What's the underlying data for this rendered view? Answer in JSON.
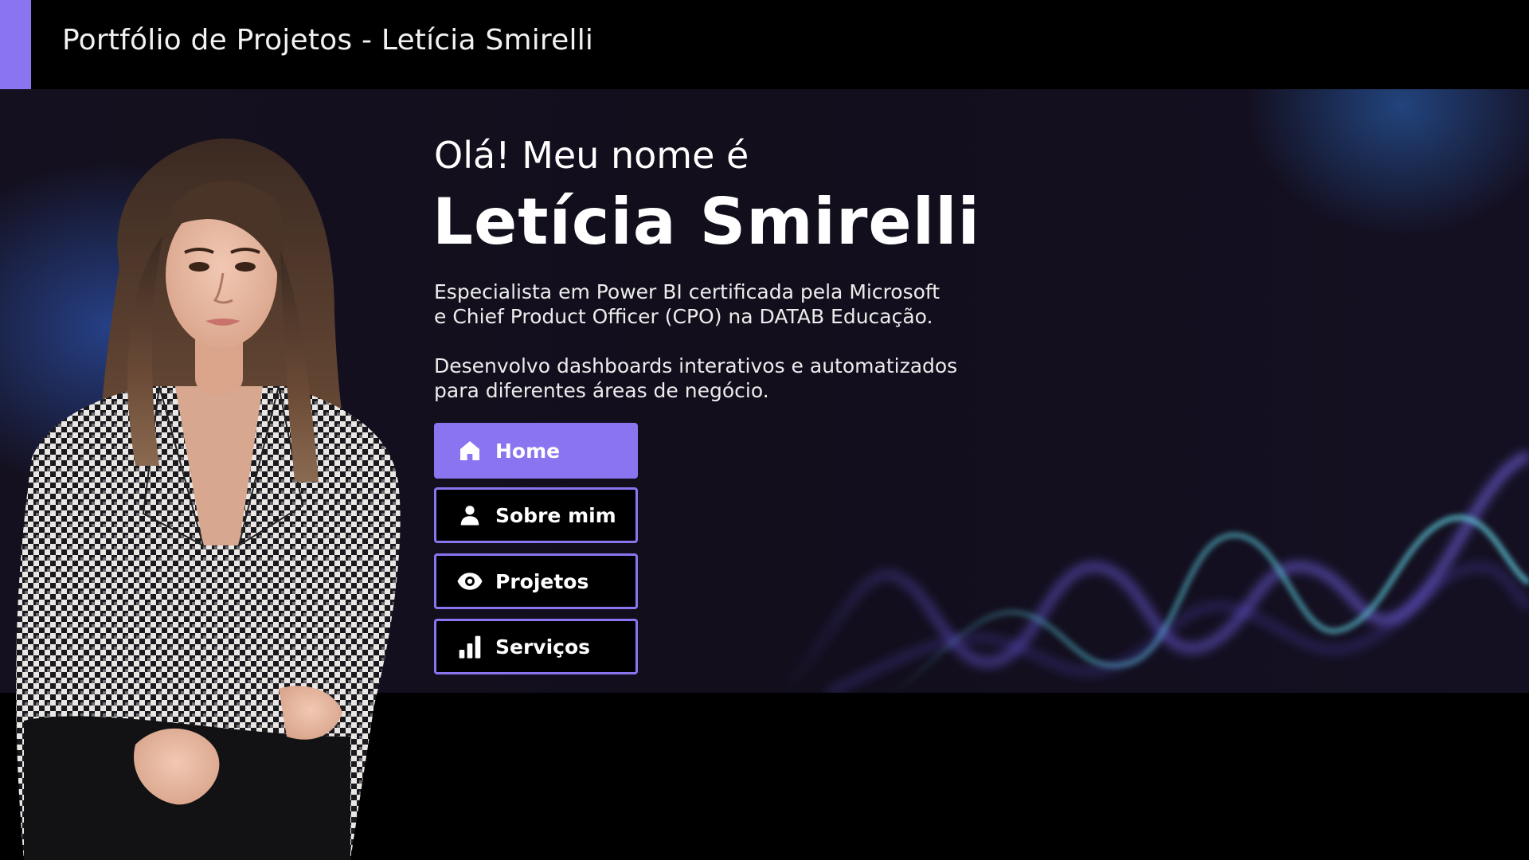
{
  "header": {
    "title": "Portfólio de Projetos - Letícia Smirelli"
  },
  "hero": {
    "greeting": "Olá! Meu nome é",
    "name": "Letícia Smirelli",
    "description_1_line_1": "Especialista em Power BI certificada pela Microsoft",
    "description_1_line_2": "e Chief Product Officer (CPO) na DATAB Educação.",
    "description_2_line_1": "Desenvolvo dashboards interativos e automatizados",
    "description_2_line_2": "para diferentes áreas de negócio."
  },
  "nav": [
    {
      "label": "Home",
      "icon": "home-icon",
      "active": true
    },
    {
      "label": "Sobre mim",
      "icon": "person-icon",
      "active": false
    },
    {
      "label": "Projetos",
      "icon": "eye-icon",
      "active": false
    },
    {
      "label": "Serviços",
      "icon": "bar-chart-icon",
      "active": false
    }
  ],
  "colors": {
    "accent": "#8b74f0",
    "background": "#000000",
    "hero_background": "#14101f"
  }
}
